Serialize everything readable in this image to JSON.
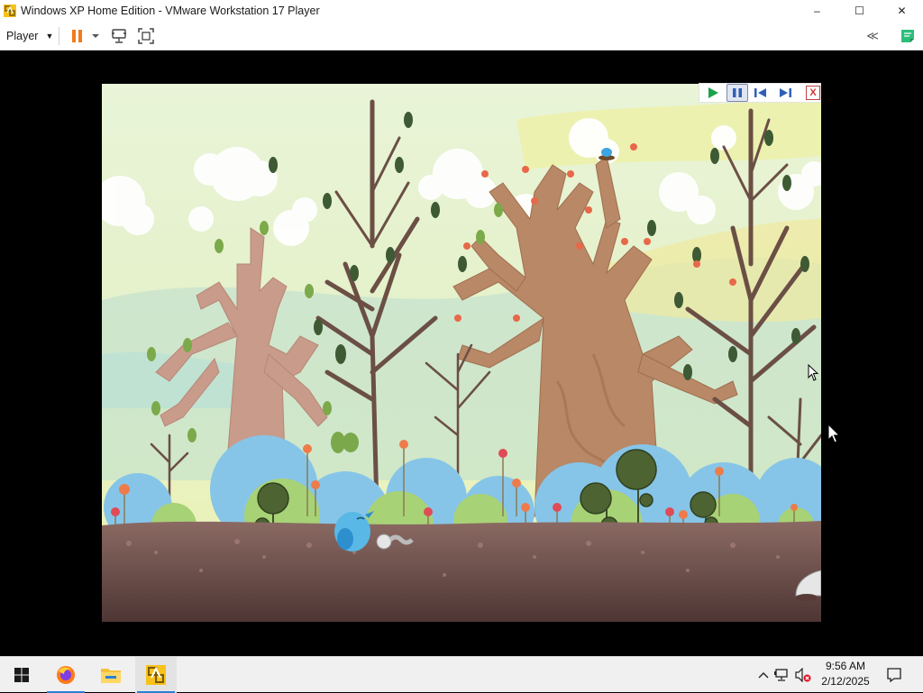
{
  "window": {
    "title": "Windows XP Home Edition - VMware Workstation 17 Player",
    "minimize_glyph": "–",
    "maximize_glyph": "☐",
    "close_glyph": "✕"
  },
  "toolbar": {
    "player_menu_label": "Player",
    "caret_glyph": "▼",
    "icons": [
      "pause-icon",
      "dropdown-caret-icon",
      "send-ctrl-alt-del-icon",
      "full-screen-icon",
      "unity-collapse-icon",
      "notes-icon"
    ],
    "collapse_glyph": "≪"
  },
  "vm": {
    "screen": "Windows XP screensaver animation: forest scene with trees, blue bird, flowers and worm",
    "media_controls": [
      "play-icon",
      "pause-icon",
      "previous-icon",
      "next-icon",
      "close-icon"
    ],
    "media_close_glyph": "X",
    "colors": {
      "accent_green": "#1aa34a",
      "accent_blue": "#2f5fb8",
      "soil": "#7d5a52",
      "sky": "#e6f2cf"
    }
  },
  "taskbar": {
    "apps": [
      "start-icon",
      "firefox-icon",
      "file-explorer-icon",
      "vmware-icon"
    ],
    "tray_icons": [
      "show-hidden-icons-chevron",
      "network-icon",
      "volume-muted-icon",
      "notifications-icon"
    ],
    "chevron_glyph": "^",
    "time": "9:56 AM",
    "date": "2/12/2025"
  }
}
